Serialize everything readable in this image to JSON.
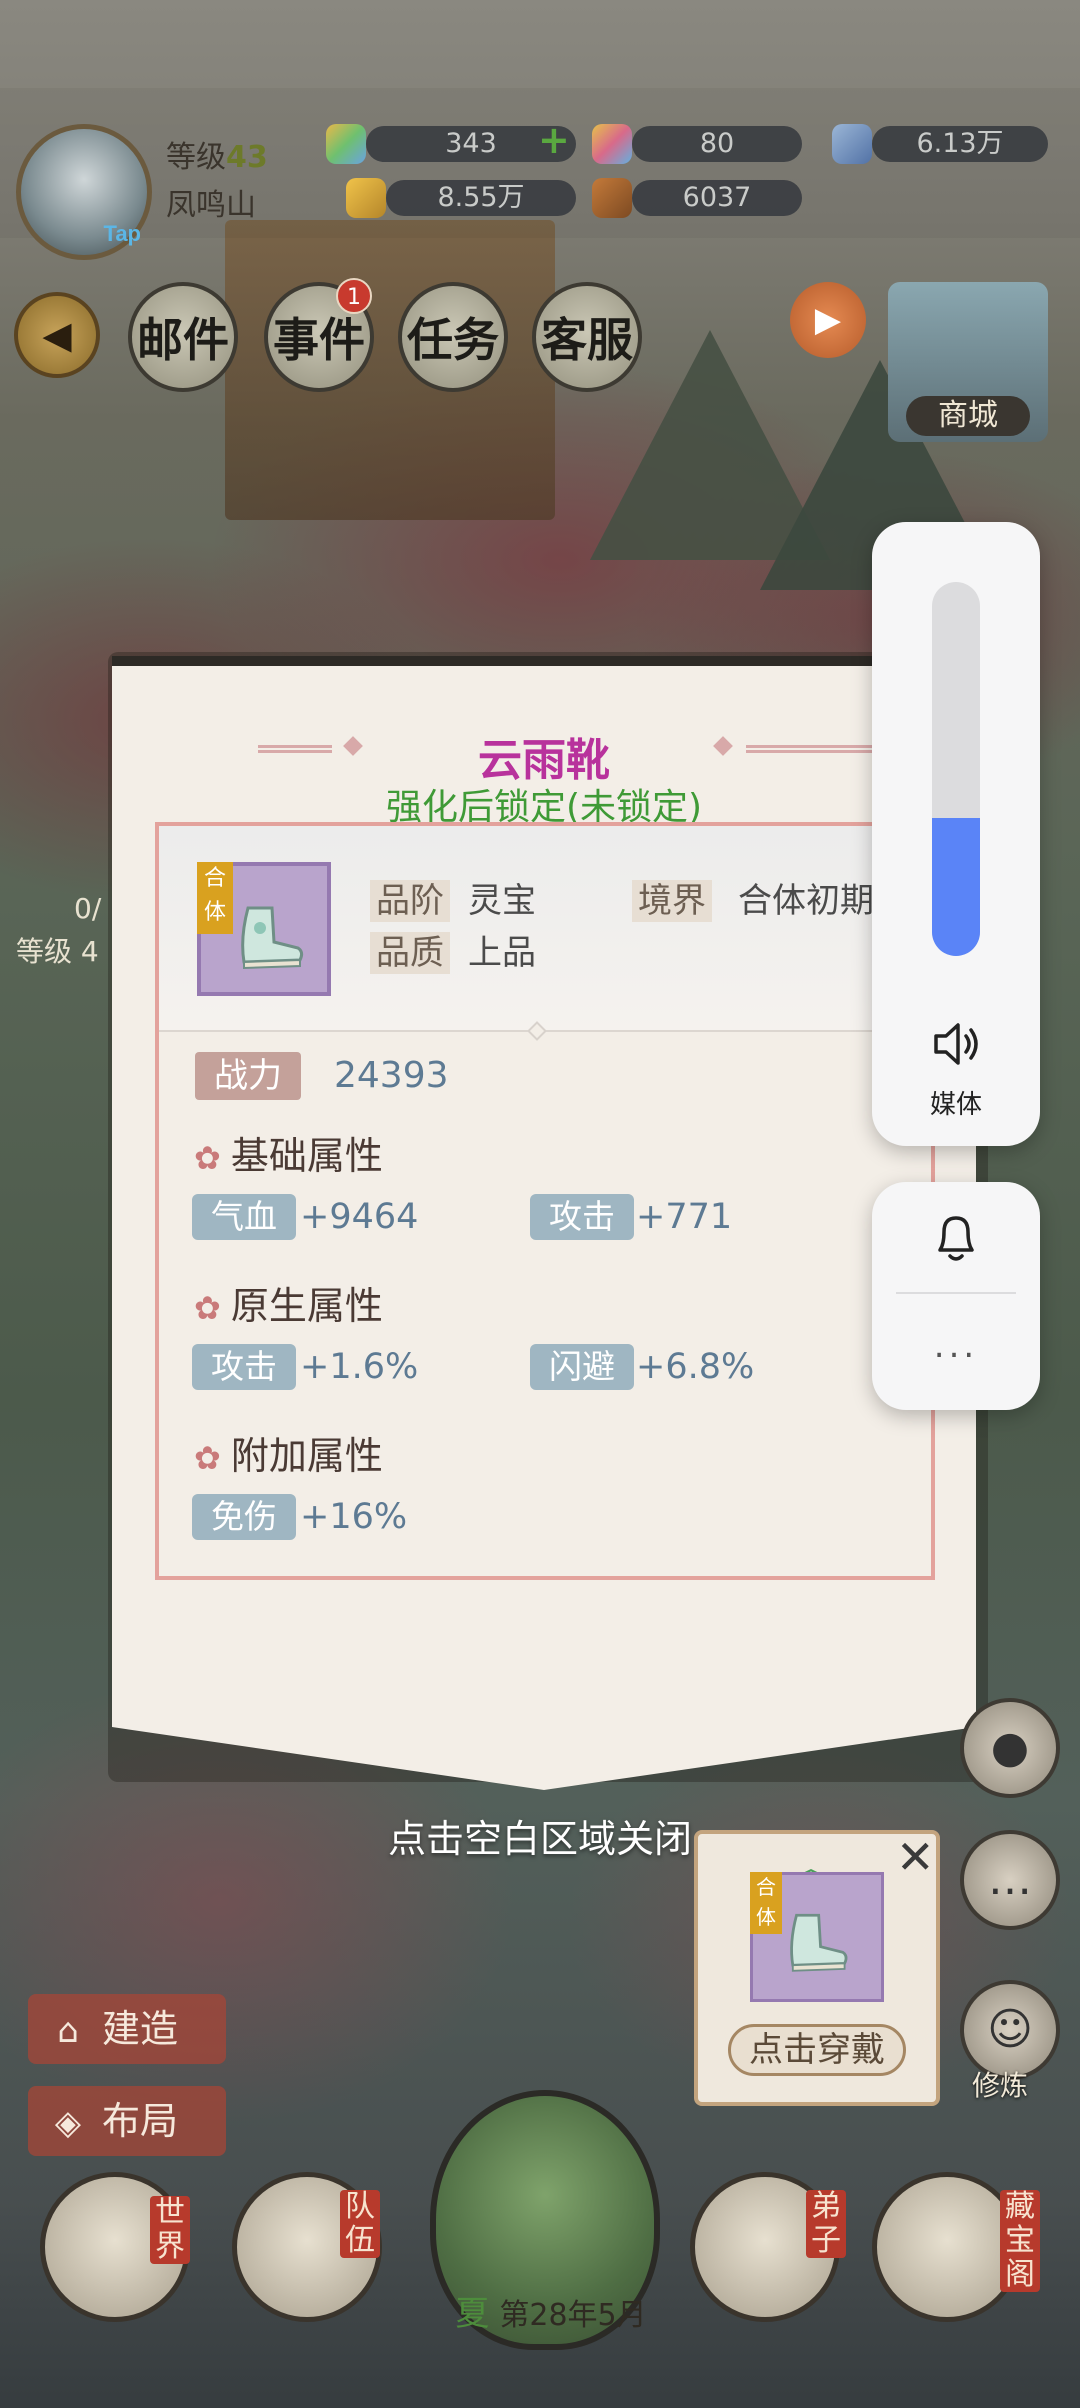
{
  "header": {
    "level_label": "等级",
    "level_value": "43",
    "region": "凤鸣山",
    "avatar_badge": "Tap",
    "resources": [
      "343",
      "80",
      "6.13万",
      "8.55万",
      "6037"
    ]
  },
  "toolbar": {
    "mail": "邮件",
    "events": "事件",
    "events_badge": "1",
    "tasks": "任务",
    "service": "客服",
    "shop": "商城"
  },
  "item": {
    "name": "云雨靴",
    "lock_status": "强化后锁定(未锁定)",
    "tag": "合体",
    "grade_label": "品阶",
    "grade_value": "灵宝",
    "realm_label": "境界",
    "realm_value": "合体初期",
    "quality_label": "品质",
    "quality_value": "上品",
    "power_label": "战力",
    "power_value": "24393",
    "sections": [
      {
        "title": "基础属性",
        "stats": [
          {
            "name": "气血",
            "value": "+9464"
          },
          {
            "name": "攻击",
            "value": "+771"
          }
        ]
      },
      {
        "title": "原生属性",
        "stats": [
          {
            "name": "攻击",
            "value": "+1.6%"
          },
          {
            "name": "闪避",
            "value": "+6.8%"
          }
        ]
      },
      {
        "title": "附加属性",
        "stats": [
          {
            "name": "免伤",
            "value": "+16%"
          }
        ]
      }
    ]
  },
  "close_hint": "点击空白区域关闭",
  "volume_overlay": {
    "level_percent": 37,
    "media_label": "媒体",
    "more": "..."
  },
  "equip_popup": {
    "tag": "合体",
    "button": "点击穿戴"
  },
  "side": {
    "cultivate": "修炼"
  },
  "left_menu": {
    "build": "建造",
    "layout": "布局",
    "left_level": "等级 4",
    "left_count": "0/"
  },
  "bottom_nav": {
    "world": "世界",
    "team": "队伍",
    "disciples": "弟子",
    "treasury": "藏宝阁",
    "season": "夏",
    "date": "第28年5月"
  },
  "colors": {
    "title": "#b8329c",
    "lock": "#3f9a36",
    "stat_value": "#5d7a93",
    "volume_fill": "#5a84f7"
  }
}
